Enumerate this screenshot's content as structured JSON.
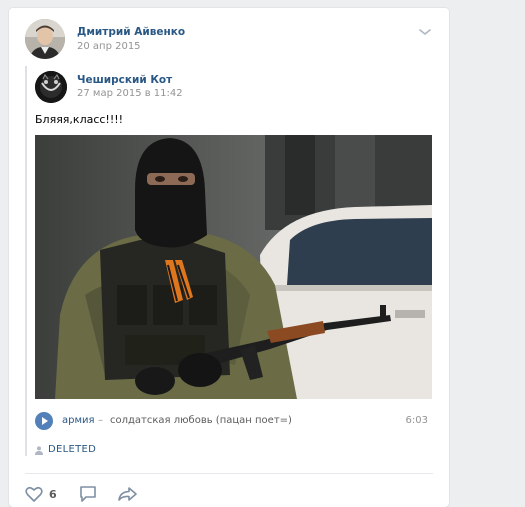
{
  "post": {
    "author": "Дмитрий Айвенко",
    "date": "20 апр 2015"
  },
  "repost": {
    "author": "Чеширский Кот",
    "date": "27 мар 2015 в 11:42",
    "text": "Бляяя,класс!!!!"
  },
  "audio": {
    "artist": "армия",
    "separator": "–",
    "title": "солдатская любовь (пацан поет=)",
    "duration": "6:03"
  },
  "source": {
    "label": "DELETED"
  },
  "actions": {
    "likes": "6"
  },
  "icons": {
    "menu": "chevron-down-icon",
    "play": "play-icon",
    "source": "person-icon",
    "like": "heart-icon",
    "comment": "comment-icon",
    "share": "share-icon"
  },
  "colors": {
    "link": "#2a5885",
    "accent": "#5181b8",
    "muted": "#939393",
    "background": "#edeef0"
  }
}
